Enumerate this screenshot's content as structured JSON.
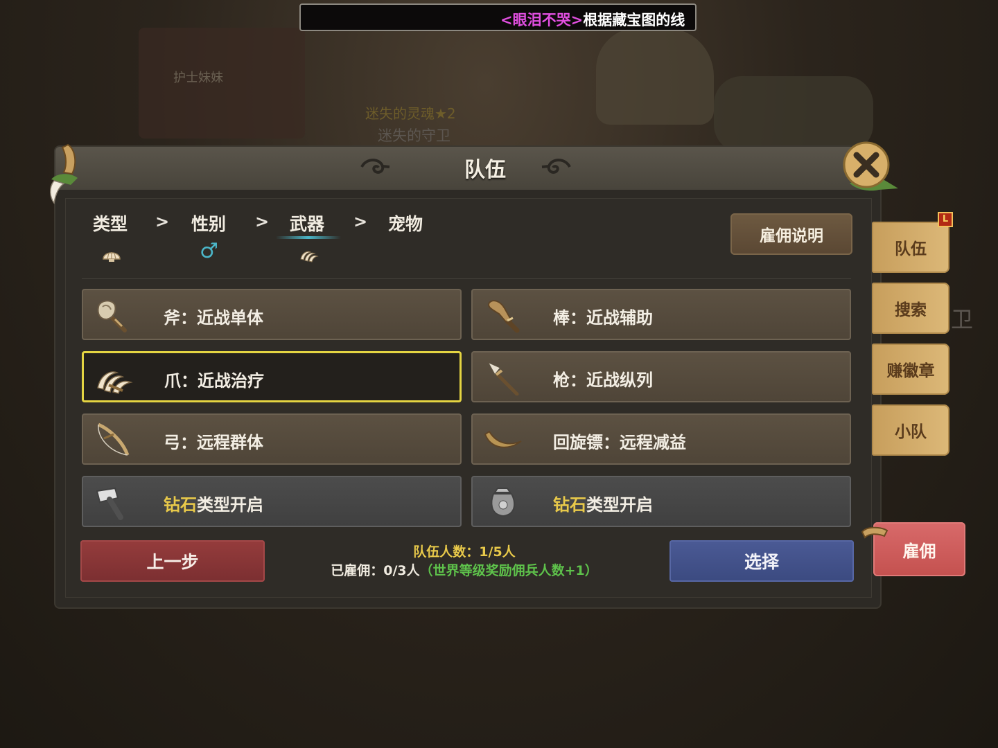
{
  "background": {
    "npc_name": "护士妹妹",
    "monster_name_1": "迷失的灵魂★2",
    "monster_name_2": "迷失的守卫",
    "side_char": "卫"
  },
  "marquee": {
    "player_name": "<眼泪不哭>",
    "message": "根据藏宝图的线"
  },
  "panel": {
    "title": "队伍",
    "help_label": "雇佣说明",
    "steps": [
      {
        "label": "类型",
        "icon": "shell-icon"
      },
      {
        "label": "性别",
        "icon": "male-symbol",
        "icon_glyph": "♂"
      },
      {
        "label": "武器",
        "icon": "claw-icon",
        "active": true
      },
      {
        "label": "宠物",
        "icon": ""
      }
    ],
    "step_separator": ">",
    "options": [
      {
        "label": "斧：近战单体",
        "icon": "axe-icon",
        "state": "normal"
      },
      {
        "label": "棒：近战辅助",
        "icon": "club-icon",
        "state": "normal"
      },
      {
        "label": "爪：近战治疗",
        "icon": "claw-icon",
        "state": "selected"
      },
      {
        "label": "枪：近战纵列",
        "icon": "spear-icon",
        "state": "normal"
      },
      {
        "label": "弓：远程群体",
        "icon": "bow-icon",
        "state": "normal"
      },
      {
        "label": "回旋镖：远程减益",
        "icon": "boomerang-icon",
        "state": "normal"
      },
      {
        "label_gold": "钻石",
        "label_rest": "类型开启",
        "icon": "hammer-icon",
        "state": "locked"
      },
      {
        "label_gold": "钻石",
        "label_rest": "类型开启",
        "icon": "pouch-icon",
        "state": "locked"
      }
    ],
    "prev_label": "上一步",
    "select_label": "选择",
    "team_count": "队伍人数：1/5人",
    "hired_prefix": "已雇佣：0/3人",
    "hired_note": "（世界等级奖励佣兵人数+1）"
  },
  "side_tabs": [
    "队伍",
    "搜索",
    "赚徽章",
    "小队"
  ],
  "side_badge": "L",
  "hire_label": "雇佣",
  "colors": {
    "selected_border": "#e4d442",
    "gold_text": "#e8c94a",
    "green_text": "#5ec24b",
    "marquee_name": "#e14fe0",
    "prev_button": "#953c3c",
    "select_button": "#4b5a95",
    "hire_button": "#d86a6a",
    "side_tab": "#d4ad6a"
  }
}
